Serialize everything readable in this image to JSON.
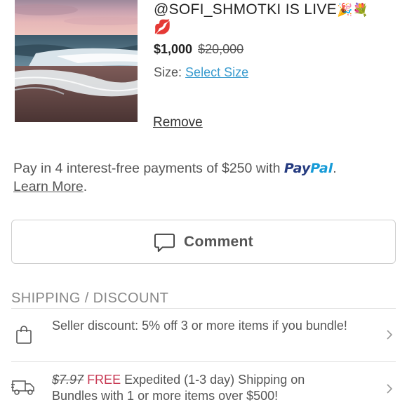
{
  "listing": {
    "title_line1": "@SOFI_SHMOTKI IS LIVE",
    "title_emoji1": "🎉💐",
    "title_emoji2": "💋",
    "price": "$1,000",
    "original_price": "$20,000",
    "size_label": "Size:",
    "size_link": "Select Size",
    "remove_label": "Remove"
  },
  "paypal": {
    "message": "Pay in 4 interest-free payments of $250 with",
    "logo_pay": "Pay",
    "logo_pal": "Pal",
    "period": ".",
    "learn_more": "Learn More",
    "trailing": "."
  },
  "comment": {
    "label": "Comment"
  },
  "shipping": {
    "section_title": "SHIPPING / DISCOUNT",
    "rows": [
      {
        "icon": "shopping-bag-icon",
        "text": "Seller discount: 5% off 3 or more items if you bundle!"
      },
      {
        "icon": "truck-icon",
        "old_price": "$7.97",
        "free_label": "FREE",
        "text": "Expedited (1-3 day) Shipping on Bundles with 1 or more items over $500!"
      }
    ]
  },
  "colors": {
    "link": "#3b9ccf",
    "paypal_dark": "#253b80",
    "paypal_light": "#179bd7",
    "free_red": "#c83a54",
    "secondary_text": "#555555"
  }
}
